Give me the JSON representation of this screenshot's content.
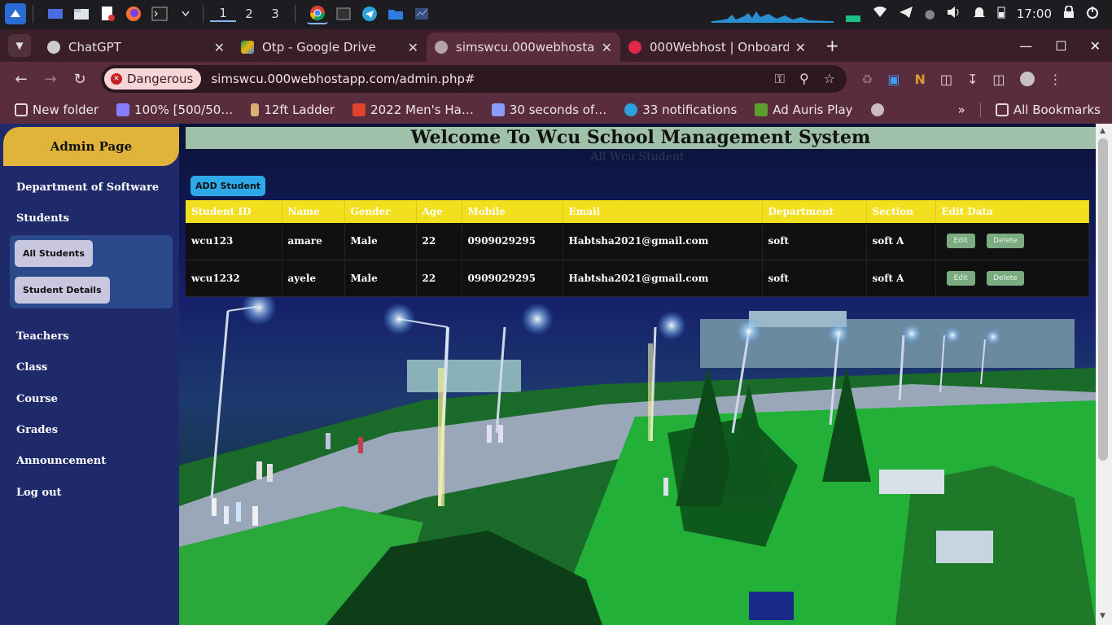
{
  "taskbar": {
    "workspaces": [
      "1",
      "2",
      "3"
    ],
    "clock": "17:00"
  },
  "tabs": [
    {
      "title": "ChatGPT",
      "favicon_color": "#cccccc"
    },
    {
      "title": "Otp - Google Drive",
      "favicon_color": "#f4b400"
    },
    {
      "title": "simswcu.000webhostapp",
      "favicon_color": "#b7a2a9"
    },
    {
      "title": "000Webhost | Onboardin",
      "favicon_color": "#e0294a"
    }
  ],
  "omnibox": {
    "security_label": "Dangerous",
    "url": "simswcu.000webhostapp.com/admin.php#"
  },
  "bookmarks": [
    {
      "label": "New folder",
      "icon_color": "#e6d8dd"
    },
    {
      "label": "100% [500/50…",
      "icon_color": "#8a7cff"
    },
    {
      "label": "12ft Ladder",
      "icon_color": "#d8b070"
    },
    {
      "label": "2022 Men's Ha…",
      "icon_color": "#e0442a"
    },
    {
      "label": "30 seconds of…",
      "icon_color": "#8a9cff"
    },
    {
      "label": "33 notifications",
      "icon_color": "#2aa3e0"
    },
    {
      "label": "Ad Auris Play",
      "icon_color": "#5aa02a"
    }
  ],
  "bookmarks_all": "All Bookmarks",
  "sidebar": {
    "title": "Admin Page",
    "items": [
      "Department of Software",
      "Students",
      "Teachers",
      "Class",
      "Course",
      "Grades",
      "Announcement",
      "Log out"
    ],
    "sub_items": [
      "All Students",
      "Student Details"
    ]
  },
  "main": {
    "welcome": "Welcome To Wcu School Management System",
    "subtitle": "All Wcu Student",
    "add_button": "ADD Student"
  },
  "table": {
    "headers": [
      "Student ID",
      "Name",
      "Gender",
      "Age",
      "Mobile",
      "Email",
      "Department",
      "Section",
      "Edit Data"
    ],
    "rows": [
      [
        "wcu123",
        "amare",
        "Male",
        "22",
        "0909029295",
        "Habtsha2021@gmail.com",
        "soft",
        "soft A"
      ],
      [
        "wcu1232",
        "ayele",
        "Male",
        "22",
        "0909029295",
        "Habtsha2021@gmail.com",
        "soft",
        "soft A"
      ]
    ],
    "edit_label": "Edit",
    "delete_label": "Delete"
  },
  "colors": {
    "header_yellow": "#f2e01f",
    "admin_gold": "#e0b43a",
    "sidebar_blue": "#1f2a6b",
    "welcome_bar": "#9fc1a9",
    "action_green": "#7bab80",
    "danger_red": "#c5221f"
  }
}
